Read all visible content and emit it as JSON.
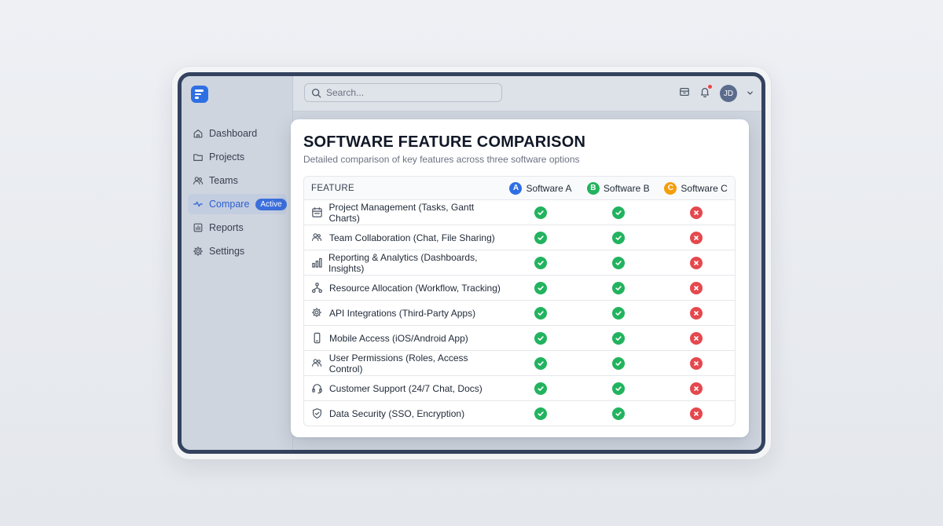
{
  "sidebar": {
    "items": [
      {
        "label": "Dashboard",
        "icon": "home-icon"
      },
      {
        "label": "Projects",
        "icon": "folder-icon"
      },
      {
        "label": "Teams",
        "icon": "users-icon"
      },
      {
        "label": "Compare",
        "icon": "compare-icon",
        "badge": "Active"
      },
      {
        "label": "Reports",
        "icon": "chart-icon"
      },
      {
        "label": "Settings",
        "icon": "gear-icon"
      }
    ]
  },
  "topbar": {
    "search_placeholder": "Search...",
    "avatar_initials": "JD"
  },
  "comparison": {
    "title": "SOFTWARE FEATURE COMPARISON",
    "subtitle": "Detailed comparison of key features across three software options",
    "feature_header": "FEATURE",
    "products": [
      {
        "letter": "A",
        "name": "Software A",
        "color": "#2f6fe4"
      },
      {
        "letter": "B",
        "name": "Software B",
        "color": "#22b35e"
      },
      {
        "letter": "C",
        "name": "Software C",
        "color": "#f59e0b"
      }
    ],
    "rows": [
      {
        "feature": "Project Management (Tasks, Gantt Charts)",
        "icon": "calendar-icon",
        "a": true,
        "b": true,
        "c": false
      },
      {
        "feature": "Team Collaboration (Chat, File Sharing)",
        "icon": "users-icon",
        "a": true,
        "b": true,
        "c": false
      },
      {
        "feature": "Reporting & Analytics (Dashboards, Insights)",
        "icon": "bar-chart-icon",
        "a": true,
        "b": true,
        "c": false
      },
      {
        "feature": "Resource Allocation (Workflow, Tracking)",
        "icon": "workflow-icon",
        "a": true,
        "b": true,
        "c": false
      },
      {
        "feature": "API Integrations (Third-Party Apps)",
        "icon": "gear-icon",
        "a": true,
        "b": true,
        "c": false
      },
      {
        "feature": "Mobile Access (iOS/Android App)",
        "icon": "phone-icon",
        "a": true,
        "b": true,
        "c": false
      },
      {
        "feature": "User Permissions (Roles, Access Control)",
        "icon": "users-icon",
        "a": true,
        "b": true,
        "c": false
      },
      {
        "feature": "Customer Support (24/7 Chat, Docs)",
        "icon": "headset-icon",
        "a": true,
        "b": true,
        "c": false
      },
      {
        "feature": "Data Security (SSO, Encryption)",
        "icon": "shield-icon",
        "a": true,
        "b": true,
        "c": false
      }
    ]
  }
}
